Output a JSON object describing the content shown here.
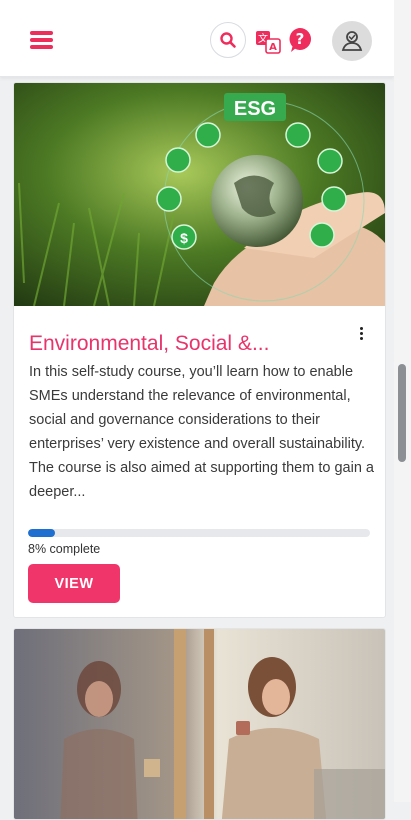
{
  "header": {
    "menu_icon": "hamburger-menu-icon",
    "search_icon": "search-icon",
    "translate_icon": "translate-icon",
    "help_icon": "question-help-icon",
    "avatar_icon": "user-avatar-icon"
  },
  "courses": [
    {
      "image_badge": "ESG",
      "title": "Environmental, Social &...",
      "description": "In this self-study course, you’ll learn how to enable SMEs understand the relevance of environmental, social and governance considerations to their enterprises’ very existence and overall sustainability. The course is also aimed at supporting them to gain a deeper...",
      "progress_percent": 8,
      "progress_text": "8% complete",
      "button_label": "VIEW"
    }
  ],
  "colors": {
    "accent": "#ee2d5c",
    "title": "#e8336b",
    "progress": "#1f6fd1",
    "button": "#f0356a"
  }
}
